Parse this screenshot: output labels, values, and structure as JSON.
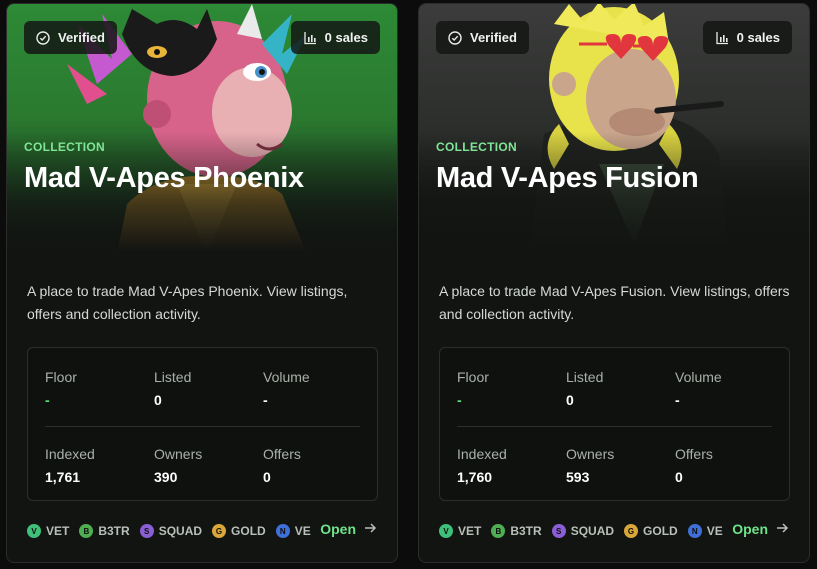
{
  "collections": [
    {
      "verified_label": "Verified",
      "sales_label": "0 sales",
      "category": "COLLECTION",
      "title": "Mad V-Apes Phoenix",
      "description": "A place to trade Mad V-Apes Phoenix. View listings, offers and collection activity.",
      "stats": {
        "floor": {
          "label": "Floor",
          "value": "-"
        },
        "listed": {
          "label": "Listed",
          "value": "0"
        },
        "volume": {
          "label": "Volume",
          "value": "-"
        },
        "indexed": {
          "label": "Indexed",
          "value": "1,761"
        },
        "owners": {
          "label": "Owners",
          "value": "390"
        },
        "offers": {
          "label": "Offers",
          "value": "0"
        }
      },
      "tokens": [
        {
          "letter": "V",
          "label": "VET",
          "color": "#3fbf7a"
        },
        {
          "letter": "B",
          "label": "B3TR",
          "color": "#4fae52"
        },
        {
          "letter": "S",
          "label": "SQUAD",
          "color": "#8a5fd6"
        },
        {
          "letter": "G",
          "label": "GOLD",
          "color": "#d9a63a"
        },
        {
          "letter": "N",
          "label": "VE",
          "color": "#3f6fd8"
        }
      ],
      "open_label": "Open"
    },
    {
      "verified_label": "Verified",
      "sales_label": "0 sales",
      "category": "COLLECTION",
      "title": "Mad V-Apes Fusion",
      "description": "A place to trade Mad V-Apes Fusion. View listings, offers and collection activity.",
      "stats": {
        "floor": {
          "label": "Floor",
          "value": "-"
        },
        "listed": {
          "label": "Listed",
          "value": "0"
        },
        "volume": {
          "label": "Volume",
          "value": "-"
        },
        "indexed": {
          "label": "Indexed",
          "value": "1,760"
        },
        "owners": {
          "label": "Owners",
          "value": "593"
        },
        "offers": {
          "label": "Offers",
          "value": "0"
        }
      },
      "tokens": [
        {
          "letter": "V",
          "label": "VET",
          "color": "#3fbf7a"
        },
        {
          "letter": "B",
          "label": "B3TR",
          "color": "#4fae52"
        },
        {
          "letter": "S",
          "label": "SQUAD",
          "color": "#8a5fd6"
        },
        {
          "letter": "G",
          "label": "GOLD",
          "color": "#d9a63a"
        },
        {
          "letter": "N",
          "label": "VE",
          "color": "#3f6fd8"
        }
      ],
      "open_label": "Open"
    }
  ],
  "icons": {
    "verified": "check-circle-icon",
    "sales": "bar-chart-icon",
    "open": "arrow-right-icon"
  }
}
